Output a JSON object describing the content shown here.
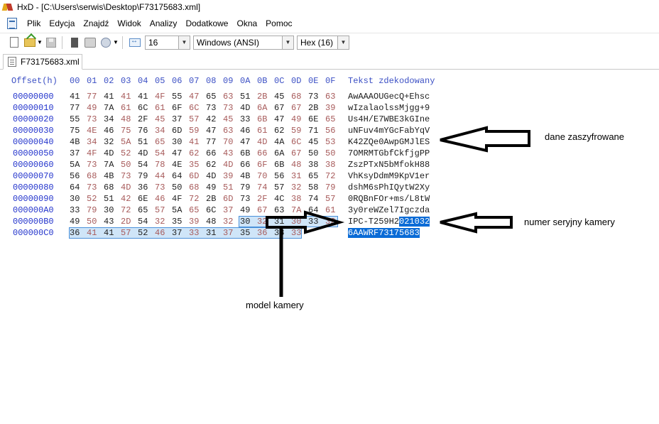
{
  "window": {
    "title": "HxD - [C:\\Users\\serwis\\Desktop\\F73175683.xml]"
  },
  "menu": [
    "Plik",
    "Edycja",
    "Znajdź",
    "Widok",
    "Analizy",
    "Dodatkowe",
    "Okna",
    "Pomoc"
  ],
  "toolbar": {
    "bytes_per_row": "16",
    "charset": "Windows (ANSI)",
    "offset_format": "Hex (16)"
  },
  "tab": {
    "label": "F73175683.xml"
  },
  "editor": {
    "offset_header": "Offset(h)",
    "col_headers": [
      "00",
      "01",
      "02",
      "03",
      "04",
      "05",
      "06",
      "07",
      "08",
      "09",
      "0A",
      "0B",
      "0C",
      "0D",
      "0E",
      "0F"
    ],
    "text_header": "Tekst zdekodowany",
    "rows": [
      {
        "offset": "00000000",
        "bytes": [
          "41",
          "77",
          "41",
          "41",
          "41",
          "4F",
          "55",
          "47",
          "65",
          "63",
          "51",
          "2B",
          "45",
          "68",
          "73",
          "63"
        ],
        "text": "AwAAAOUGecQ+Ehsc"
      },
      {
        "offset": "00000010",
        "bytes": [
          "77",
          "49",
          "7A",
          "61",
          "6C",
          "61",
          "6F",
          "6C",
          "73",
          "73",
          "4D",
          "6A",
          "67",
          "67",
          "2B",
          "39"
        ],
        "text": "wIzalaolssMjgg+9"
      },
      {
        "offset": "00000020",
        "bytes": [
          "55",
          "73",
          "34",
          "48",
          "2F",
          "45",
          "37",
          "57",
          "42",
          "45",
          "33",
          "6B",
          "47",
          "49",
          "6E",
          "65"
        ],
        "text": "Us4H/E7WBE3kGIne"
      },
      {
        "offset": "00000030",
        "bytes": [
          "75",
          "4E",
          "46",
          "75",
          "76",
          "34",
          "6D",
          "59",
          "47",
          "63",
          "46",
          "61",
          "62",
          "59",
          "71",
          "56"
        ],
        "text": "uNFuv4mYGcFabYqV"
      },
      {
        "offset": "00000040",
        "bytes": [
          "4B",
          "34",
          "32",
          "5A",
          "51",
          "65",
          "30",
          "41",
          "77",
          "70",
          "47",
          "4D",
          "4A",
          "6C",
          "45",
          "53"
        ],
        "text": "K42ZQe0AwpGMJlES"
      },
      {
        "offset": "00000050",
        "bytes": [
          "37",
          "4F",
          "4D",
          "52",
          "4D",
          "54",
          "47",
          "62",
          "66",
          "43",
          "6B",
          "66",
          "6A",
          "67",
          "50",
          "50"
        ],
        "text": "7OMRMTGbfCkfjgPP"
      },
      {
        "offset": "00000060",
        "bytes": [
          "5A",
          "73",
          "7A",
          "50",
          "54",
          "78",
          "4E",
          "35",
          "62",
          "4D",
          "66",
          "6F",
          "6B",
          "48",
          "38",
          "38"
        ],
        "text": "ZszPTxN5bMfokH88"
      },
      {
        "offset": "00000070",
        "bytes": [
          "56",
          "68",
          "4B",
          "73",
          "79",
          "44",
          "64",
          "6D",
          "4D",
          "39",
          "4B",
          "70",
          "56",
          "31",
          "65",
          "72"
        ],
        "text": "VhKsyDdmM9KpV1er"
      },
      {
        "offset": "00000080",
        "bytes": [
          "64",
          "73",
          "68",
          "4D",
          "36",
          "73",
          "50",
          "68",
          "49",
          "51",
          "79",
          "74",
          "57",
          "32",
          "58",
          "79"
        ],
        "text": "dshM6sPhIQytW2Xy"
      },
      {
        "offset": "00000090",
        "bytes": [
          "30",
          "52",
          "51",
          "42",
          "6E",
          "46",
          "4F",
          "72",
          "2B",
          "6D",
          "73",
          "2F",
          "4C",
          "38",
          "74",
          "57"
        ],
        "text": "0RQBnFOr+ms/L8tW"
      },
      {
        "offset": "000000A0",
        "bytes": [
          "33",
          "79",
          "30",
          "72",
          "65",
          "57",
          "5A",
          "65",
          "6C",
          "37",
          "49",
          "67",
          "63",
          "7A",
          "64",
          "61"
        ],
        "text": "3y0reWZel7Igczda"
      },
      {
        "offset": "000000B0",
        "bytes": [
          "49",
          "50",
          "43",
          "2D",
          "54",
          "32",
          "35",
          "39",
          "48",
          "32",
          "30",
          "32",
          "31",
          "30",
          "33",
          "32"
        ],
        "text": "IPC-T259H2",
        "text_sel": "021032"
      },
      {
        "offset": "000000C0",
        "bytes": [
          "36",
          "41",
          "41",
          "57",
          "52",
          "46",
          "37",
          "33",
          "31",
          "37",
          "35",
          "36",
          "38",
          "33"
        ],
        "text": "",
        "text_sel": "6AAWRF73175683"
      }
    ]
  },
  "annotations": {
    "encrypted": "dane zaszyfrowane",
    "serial": "numer seryjny kamery",
    "model": "model kamery"
  }
}
